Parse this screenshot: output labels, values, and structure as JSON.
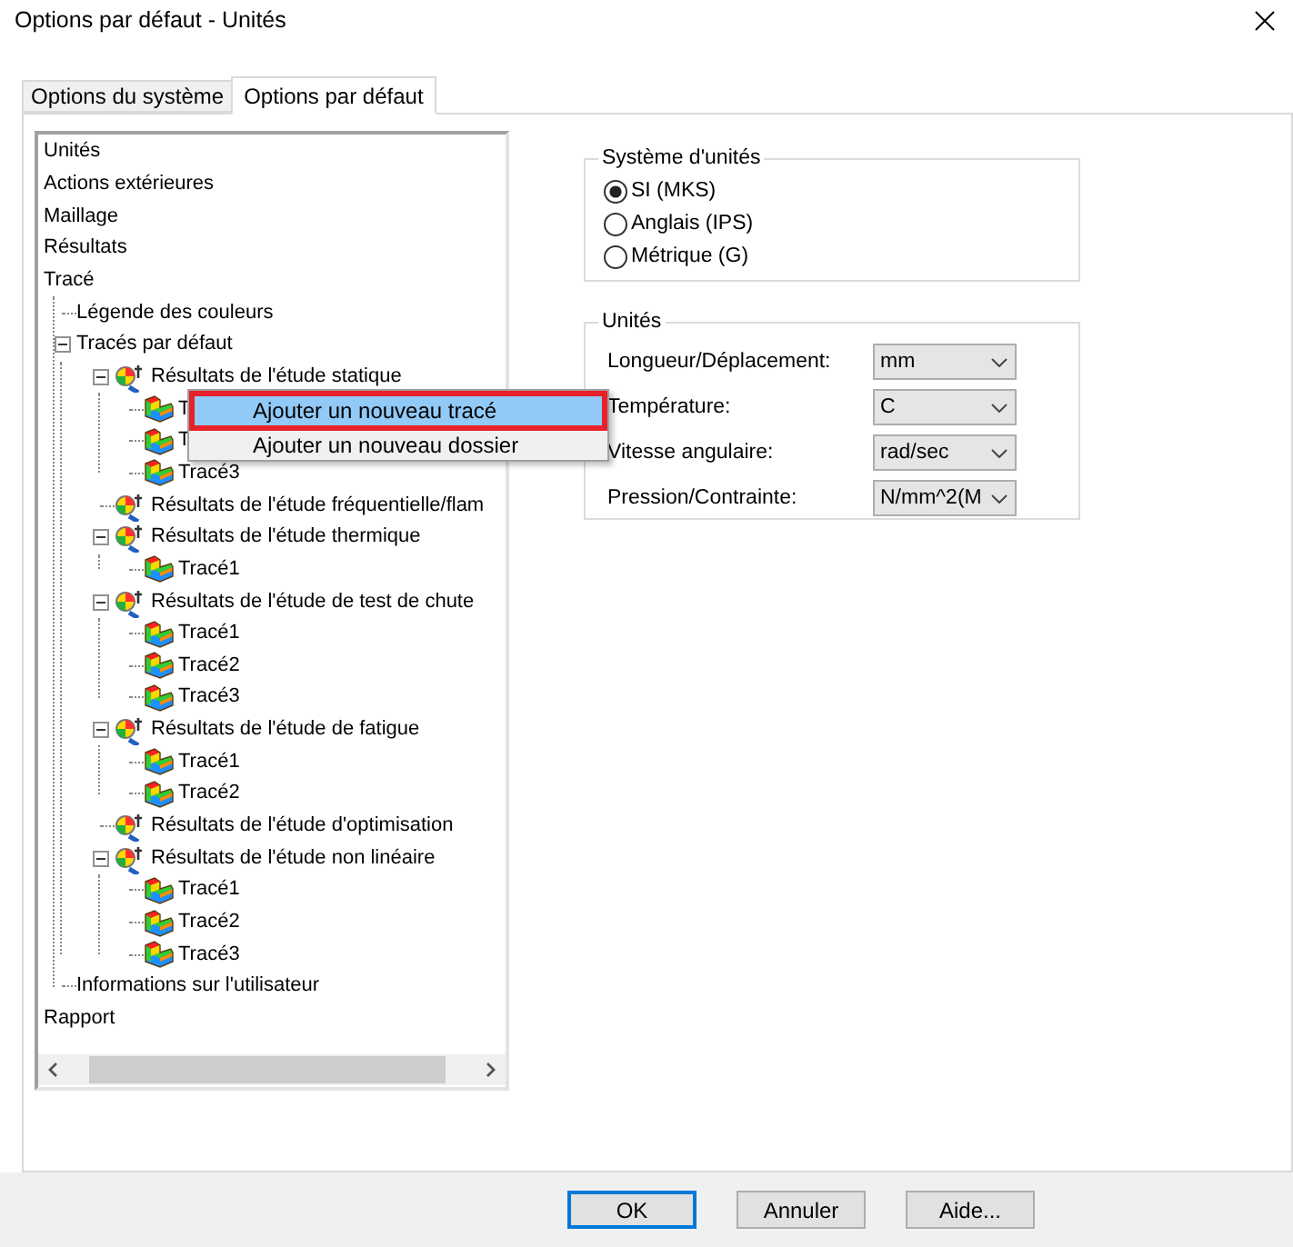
{
  "window": {
    "title": "Options par défaut - Unités"
  },
  "tabs": [
    {
      "label": "Options du système",
      "selected": false
    },
    {
      "label": "Options par défaut",
      "selected": true
    }
  ],
  "tree": {
    "items": [
      {
        "label": "Unités"
      },
      {
        "label": "Actions extérieures"
      },
      {
        "label": "Maillage"
      },
      {
        "label": "Résultats"
      },
      {
        "label": "Tracé",
        "children": [
          {
            "label": "Légende des couleurs"
          },
          {
            "label": "Tracés par défaut",
            "children": [
              {
                "label": "Résultats de l'étude statique",
                "kind": "study",
                "children": [
                  {
                    "label": "T",
                    "kind": "plot"
                  },
                  {
                    "label": "T",
                    "kind": "plot"
                  },
                  {
                    "label": "Tracé3",
                    "kind": "plot"
                  }
                ]
              },
              {
                "label": "Résultats de l'étude fréquentielle/flam",
                "kind": "study"
              },
              {
                "label": "Résultats de l'étude thermique",
                "kind": "study",
                "children": [
                  {
                    "label": "Tracé1",
                    "kind": "plot"
                  }
                ]
              },
              {
                "label": "Résultats de l'étude de test de chute",
                "kind": "study",
                "children": [
                  {
                    "label": "Tracé1",
                    "kind": "plot"
                  },
                  {
                    "label": "Tracé2",
                    "kind": "plot"
                  },
                  {
                    "label": "Tracé3",
                    "kind": "plot"
                  }
                ]
              },
              {
                "label": "Résultats de l'étude de fatigue",
                "kind": "study",
                "children": [
                  {
                    "label": "Tracé1",
                    "kind": "plot"
                  },
                  {
                    "label": "Tracé2",
                    "kind": "plot"
                  }
                ]
              },
              {
                "label": "Résultats de l'étude d'optimisation",
                "kind": "study"
              },
              {
                "label": "Résultats de l'étude non linéaire",
                "kind": "study",
                "children": [
                  {
                    "label": "Tracé1",
                    "kind": "plot"
                  },
                  {
                    "label": "Tracé2",
                    "kind": "plot"
                  },
                  {
                    "label": "Tracé3",
                    "kind": "plot"
                  }
                ]
              }
            ]
          },
          {
            "label": "Informations sur l'utilisateur"
          }
        ]
      },
      {
        "label": "Rapport"
      }
    ]
  },
  "context_menu": {
    "items": [
      {
        "label": "Ajouter un nouveau tracé",
        "selected": true
      },
      {
        "label": "Ajouter un nouveau dossier",
        "selected": false
      }
    ]
  },
  "unit_system": {
    "title": "Système d'unités",
    "options": [
      {
        "label": "SI (MKS)",
        "selected": true
      },
      {
        "label": "Anglais (IPS)",
        "selected": false
      },
      {
        "label": "Métrique (G)",
        "selected": false
      }
    ]
  },
  "units": {
    "title": "Unités",
    "rows": [
      {
        "label": "Longueur/Déplacement:",
        "value": "mm"
      },
      {
        "label": "Température:",
        "value": "C"
      },
      {
        "label": "Vitesse angulaire:",
        "value": "rad/sec"
      },
      {
        "label": "Pression/Contrainte:",
        "value": "N/mm^2(M"
      }
    ]
  },
  "buttons": [
    {
      "label": "OK",
      "default": true
    },
    {
      "label": "Annuler",
      "default": false
    },
    {
      "label": "Aide...",
      "default": false
    }
  ]
}
